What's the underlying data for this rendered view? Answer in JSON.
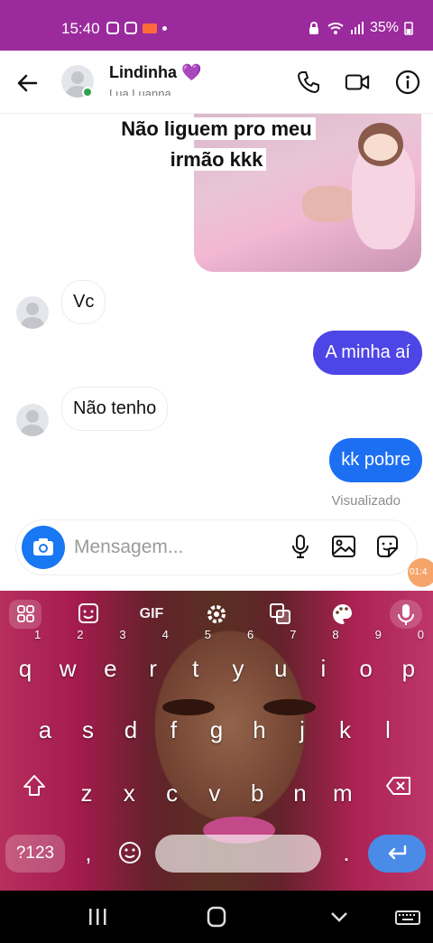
{
  "status_bar": {
    "time": "15:40",
    "battery": "35%"
  },
  "header": {
    "contact_name": "Lindinha",
    "contact_emoji": "💜",
    "subtitle": "Lua Luanna"
  },
  "chat": {
    "image_caption": [
      "Não liguem pro meu",
      "irmão kkk"
    ],
    "messages": [
      {
        "direction": "in",
        "text": "Vc"
      },
      {
        "direction": "out",
        "text": "A minha aí",
        "color": "#4d45e6"
      },
      {
        "direction": "in",
        "text": "Não tenho"
      },
      {
        "direction": "out",
        "text": "kk pobre",
        "color": "#1d6ff2"
      }
    ],
    "seen_label": "Visualizado"
  },
  "composer": {
    "placeholder": "Mensagem...",
    "floating_badge": "01:4"
  },
  "keyboard": {
    "toolbar": [
      "grid-icon",
      "sticker-icon",
      "GIF",
      "gear-icon",
      "translate-icon",
      "palette-icon",
      "mic-icon"
    ],
    "gif_label": "GIF",
    "row1": [
      "q",
      "w",
      "e",
      "r",
      "t",
      "y",
      "u",
      "i",
      "o",
      "p"
    ],
    "row1_hints": [
      "1",
      "2",
      "3",
      "4",
      "5",
      "6",
      "7",
      "8",
      "9",
      "0"
    ],
    "row2": [
      "a",
      "s",
      "d",
      "f",
      "g",
      "h",
      "j",
      "k",
      "l"
    ],
    "row3": [
      "z",
      "x",
      "c",
      "v",
      "b",
      "n",
      "m"
    ],
    "symbols_label": "?123",
    "comma": ",",
    "period": "."
  },
  "colors": {
    "status_bar": "#9b2a9d",
    "messenger_blue": "#1877f2",
    "sent_bubble_purple": "#4d45e6",
    "sent_bubble_blue": "#1d6ff2"
  }
}
